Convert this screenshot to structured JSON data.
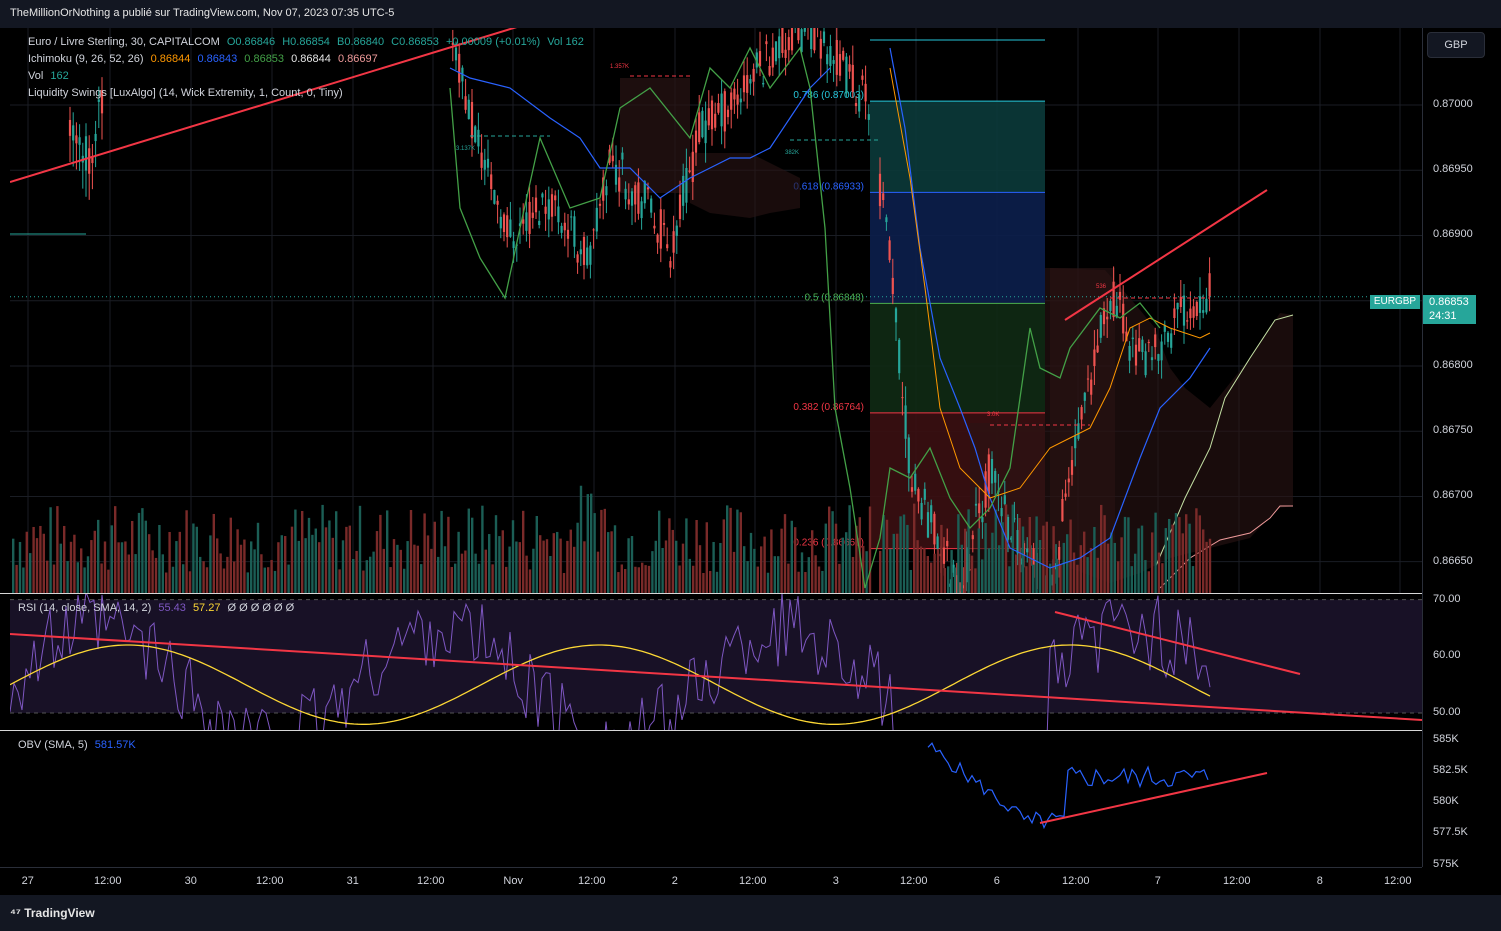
{
  "header": {
    "published": "TheMillionOrNothing a publié sur TradingView.com, Nov 07, 2023 07:35 UTC-5"
  },
  "legend": {
    "symbol": "Euro / Livre Sterling, 30, CAPITALCOM",
    "o": "O0.86846",
    "h": "H0.86854",
    "b": "B0.86840",
    "c": "C0.86853",
    "chg": "+0.00009 (+0.01%)",
    "vol": "Vol 162",
    "ichimoku_name": "Ichimoku (9, 26, 52, 26)",
    "ichimoku_vals": [
      "0.86844",
      "0.86843",
      "0.86853",
      "0.86844",
      "0.86697"
    ],
    "vol_name": "Vol",
    "vol_val": "162",
    "liq": "Liquidity Swings [LuxAlgo] (14, Wick Extremity, 1, Count, 0, Tiny)"
  },
  "rsi_legend": {
    "name": "RSI (14, close, SMA, 14, 2)",
    "v1": "55.43",
    "v2": "57.27",
    "rest": "Ø Ø Ø Ø Ø Ø"
  },
  "obv_legend": {
    "name": "OBV (SMA, 5)",
    "v": "581.57K"
  },
  "currency": "GBP",
  "symbol_badge": "EURGBP",
  "last_price": "0.86853",
  "countdown": "24:31",
  "colors": {
    "up": "#26a69a",
    "down": "#ef5350",
    "trend": "#f23645",
    "rsi": "#7e57c2",
    "rsi_ma": "#fdd835",
    "obv": "#2962ff",
    "tenkan": "#2962ff",
    "kijun": "#ff9800",
    "chikou": "#43a047"
  },
  "chart_data": {
    "type": "candlestick",
    "symbol": "EURGBP",
    "timeframe": "30",
    "price_axis": [
      "0.87000",
      "0.86950",
      "0.86900",
      "0.86850",
      "0.86800",
      "0.86750",
      "0.86700",
      "0.86650"
    ],
    "price_range": [
      0.86626,
      0.87059
    ],
    "time_axis": [
      "27",
      "12:00",
      "30",
      "12:00",
      "31",
      "12:00",
      "Nov",
      "12:00",
      "2",
      "12:00",
      "3",
      "12:00",
      "6",
      "12:00",
      "7",
      "12:00",
      "8",
      "12:00"
    ],
    "fib_levels": [
      {
        "label": "0.786 (0.87003)",
        "price": 0.87003,
        "color": "#26c6da"
      },
      {
        "label": "0.618 (0.86933)",
        "price": 0.86933,
        "color": "#2962ff"
      },
      {
        "label": "0.5 (0.86848)",
        "price": 0.86848,
        "color": "#4caf50"
      },
      {
        "label": "0.382 (0.86764)",
        "price": 0.86764,
        "color": "#f23645"
      },
      {
        "label": "0.236 (0.86660)",
        "price": 0.8666,
        "color": "#f23645"
      }
    ],
    "annotations": [
      "3.137K",
      "1.357K",
      "382K",
      "536",
      "3.0K"
    ],
    "rsi_axis": [
      "70.00",
      "60.00",
      "50.00"
    ],
    "rsi_range": [
      47,
      71
    ],
    "obv_axis": [
      "585K",
      "582.5K",
      "580K",
      "577.5K",
      "575K"
    ],
    "obv_range": [
      574.8,
      585.7
    ]
  }
}
